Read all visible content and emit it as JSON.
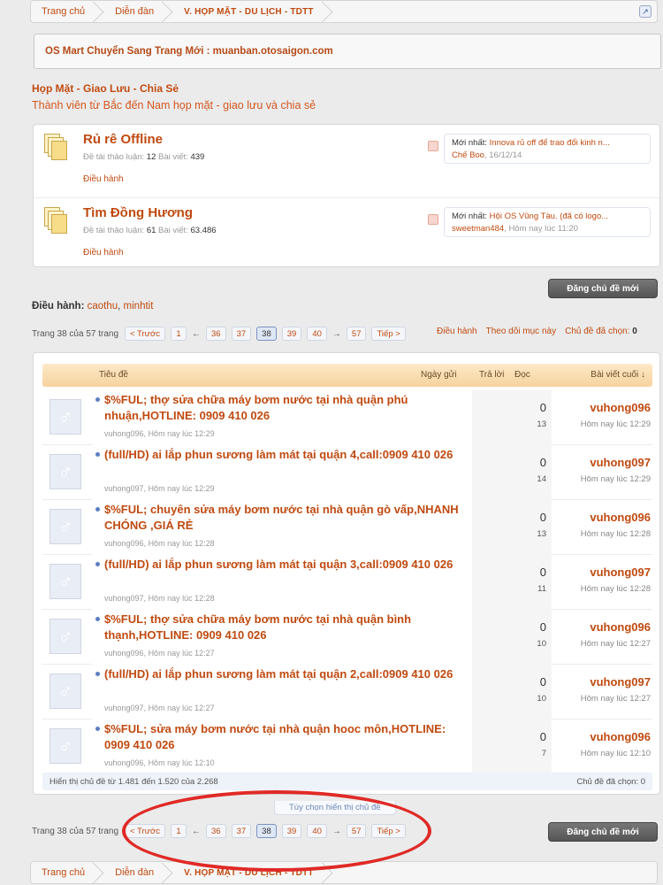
{
  "breadcrumb": {
    "items": [
      "Trang chủ",
      "Diễn đàn",
      "V. HỌP MẶT - DU LỊCH - TDTT"
    ],
    "icon": "jump-icon"
  },
  "notice": "OS Mart Chuyển Sang Trang Mới : muanban.otosaigon.com",
  "category": {
    "title": "Họp Mặt - Giao Lưu - Chia Sẻ",
    "description": "Thành viên từ Bắc đến Nam họp mặt - giao lưu và chia sẻ"
  },
  "forums": [
    {
      "title": "Rủ rê Offline",
      "topics_label": "Đề tài thảo luận:",
      "topics": "12",
      "posts_label": "Bài viết:",
      "posts": "439",
      "moderate": "Điều hành",
      "latest_label": "Mới nhất:",
      "latest_title": "Innova rủ off để trao đổi kinh n...",
      "latest_user": "Chế Boo",
      "latest_time": "16/12/14"
    },
    {
      "title": "Tìm Đồng Hương",
      "topics_label": "Đề tài thảo luận:",
      "topics": "61",
      "posts_label": "Bài viết:",
      "posts": "63.486",
      "moderate": "Điều hành",
      "latest_label": "Mới nhất:",
      "latest_title": "Hội OS Vũng Tàu. (đã có logo...",
      "latest_user": "sweetman484",
      "latest_time": "Hôm nay lúc 11:20"
    }
  ],
  "post_button": "Đăng chủ đề mới",
  "moderators": {
    "label": "Điều hành:",
    "names": [
      "caothu",
      "minhtit"
    ]
  },
  "pagination": {
    "info": "Trang 38 của 57 trang",
    "prev": "< Trước",
    "first": "1",
    "pages": [
      "36",
      "37",
      "38",
      "39",
      "40"
    ],
    "current": "38",
    "last": "57",
    "next": "Tiếp >",
    "arrow_left": "←",
    "arrow_right": "→"
  },
  "tools": {
    "moderate": "Điều hành",
    "watch": "Theo dõi mục này",
    "selected_label": "Chủ đề đã chọn:",
    "selected_count": "0"
  },
  "thread_header": {
    "title": "Tiêu đề",
    "start_date": "Ngày gửi",
    "replies": "Trả lời",
    "views": "Đọc",
    "last_post": "Bài viết cuối ↓"
  },
  "threads": [
    {
      "title": "$%FUL; thợ sửa chữa máy bơm nước tại nhà quận phú nhuận,HOTLINE: 0909 410 026",
      "author": "vuhong096",
      "time": "Hôm nay lúc 12:29",
      "replies": "0",
      "views": "13",
      "last_user": "vuhong096",
      "last_time": "Hôm nay lúc 12:29"
    },
    {
      "title": "(full/HD) ai lắp phun sương làm mát tại quận 4,call:0909 410 026",
      "author": "vuhong097",
      "time": "Hôm nay lúc 12:29",
      "replies": "0",
      "views": "14",
      "last_user": "vuhong097",
      "last_time": "Hôm nay lúc 12:29"
    },
    {
      "title": "$%FUL; chuyên sửa máy bơm nước tại nhà quận gò vấp,NHANH CHÓNG ,GIÁ RẺ",
      "author": "vuhong096",
      "time": "Hôm nay lúc 12:28",
      "replies": "0",
      "views": "13",
      "last_user": "vuhong096",
      "last_time": "Hôm nay lúc 12:28"
    },
    {
      "title": "(full/HD) ai lắp phun sương làm mát tại quận 3,call:0909 410 026",
      "author": "vuhong097",
      "time": "Hôm nay lúc 12:28",
      "replies": "0",
      "views": "11",
      "last_user": "vuhong097",
      "last_time": "Hôm nay lúc 12:28"
    },
    {
      "title": "$%FUL; thợ sửa chữa máy bơm nước tại nhà quận bình thạnh,HOTLINE: 0909 410 026",
      "author": "vuhong096",
      "time": "Hôm nay lúc 12:27",
      "replies": "0",
      "views": "10",
      "last_user": "vuhong096",
      "last_time": "Hôm nay lúc 12:27"
    },
    {
      "title": "(full/HD) ai lắp phun sương làm mát tại quận 2,call:0909 410 026",
      "author": "vuhong097",
      "time": "Hôm nay lúc 12:27",
      "replies": "0",
      "views": "10",
      "last_user": "vuhong097",
      "last_time": "Hôm nay lúc 12:27"
    },
    {
      "title": "$%FUL; sửa máy bơm nước tại nhà quận hooc môn,HOTLINE: 0909 410 026",
      "author": "vuhong096",
      "time": "Hôm nay lúc 12:10",
      "replies": "0",
      "views": "7",
      "last_user": "vuhong096",
      "last_time": "Hôm nay lúc 12:10"
    }
  ],
  "thread_footer": {
    "showing": "Hiển thị chủ đề từ 1.481 đến 1.520 của 2.268",
    "selected": "Chủ đề đã chọn: 0"
  },
  "display_options": "Tùy chọn hiển thị chủ đề",
  "colors": {
    "link": "#c04a10",
    "header_bg": "#f6d39d",
    "annotation_circle": "#e02a26"
  }
}
